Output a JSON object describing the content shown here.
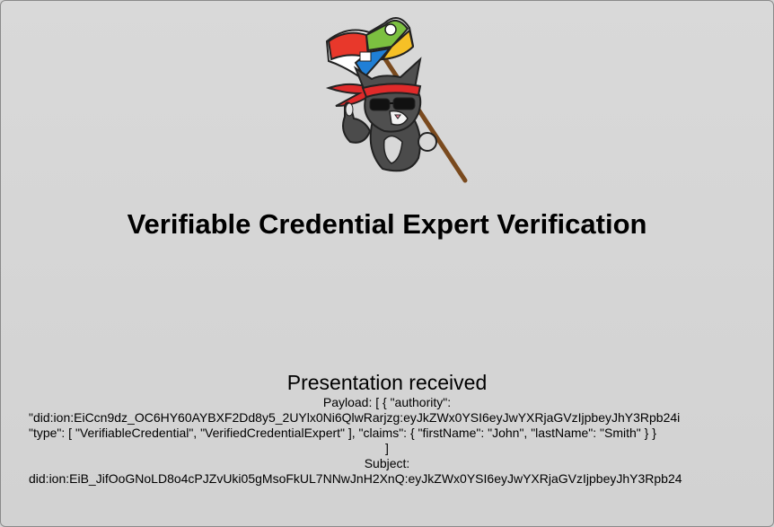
{
  "page": {
    "title": "Verifiable Credential Expert Verification"
  },
  "mascot": {
    "icon": "ninja-cat-flag-icon"
  },
  "presentation": {
    "heading": "Presentation received",
    "payload_label": "Payload: [ { \"authority\":",
    "payload_line_1": "\"did:ion:EiCcn9dz_OC6HY60AYBXF2Dd8y5_2UYlx0Ni6QlwRarjzg:eyJkZWx0YSI6eyJwYXRjaGVzIjpbeyJhY3Rpb24i",
    "payload_line_2": "\"type\": [ \"VerifiableCredential\", \"VerifiedCredentialExpert\" ], \"claims\": { \"firstName\": \"John\", \"lastName\": \"Smith\" } }",
    "payload_close": "]",
    "subject_label": "Subject:",
    "subject_value": "did:ion:EiB_JifOoGNoLD8o4cPJZvUki05gMsoFkUL7NNwJnH2XnQ:eyJkZWx0YSI6eyJwYXRjaGVzIjpbeyJhY3Rpb24"
  },
  "colors": {
    "background": "#d4d4d4",
    "flag_red": "#e8382b",
    "flag_green": "#7cc040",
    "flag_blue": "#1f7fd6",
    "flag_yellow": "#f6c026",
    "bandana": "#e02a2a"
  }
}
